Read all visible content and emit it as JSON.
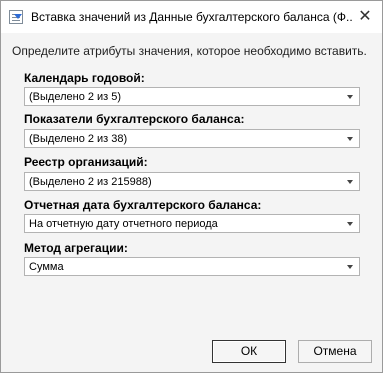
{
  "window": {
    "title": "Вставка значений из Данные бухгалтерского баланса (Ф...",
    "close_glyph": "✕",
    "icon": "table-insert-icon"
  },
  "instruction": "Определите атрибуты значения, которое необходимо вставить.",
  "fields": [
    {
      "label": "Календарь годовой:",
      "value": "(Выделено 2 из 5)"
    },
    {
      "label": "Показатели бухгалтерского баланса:",
      "value": "(Выделено 2 из 38)"
    },
    {
      "label": "Реестр организаций:",
      "value": "(Выделено 2 из 215988)"
    },
    {
      "label": "Отчетная дата бухгалтерского баланса:",
      "value": "На отчетную дату отчетного периода"
    },
    {
      "label": "Метод агрегации:",
      "value": "Сумма"
    }
  ],
  "buttons": {
    "ok": "ОК",
    "cancel": "Отмена"
  }
}
